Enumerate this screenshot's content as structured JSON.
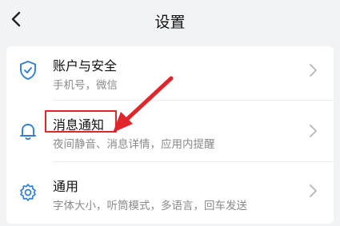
{
  "header": {
    "title": "设置",
    "back_icon": "chevron-left-icon"
  },
  "settings": {
    "items": [
      {
        "title": "账户与安全",
        "subtitle": "手机号，微信",
        "icon": "shield-check-icon"
      },
      {
        "title": "消息通知",
        "subtitle": "夜间静音、消息详情，应用内提醒",
        "icon": "bell-icon"
      },
      {
        "title": "通用",
        "subtitle": "字体大小，听筒模式，多语言，回车发送",
        "icon": "gear-icon"
      }
    ]
  },
  "annotation": {
    "highlight_color": "#e0262b",
    "arrow_color": "#e0262b"
  },
  "colors": {
    "accent": "#2f7fd8",
    "background": "#f2f3f5",
    "card": "#ffffff"
  }
}
